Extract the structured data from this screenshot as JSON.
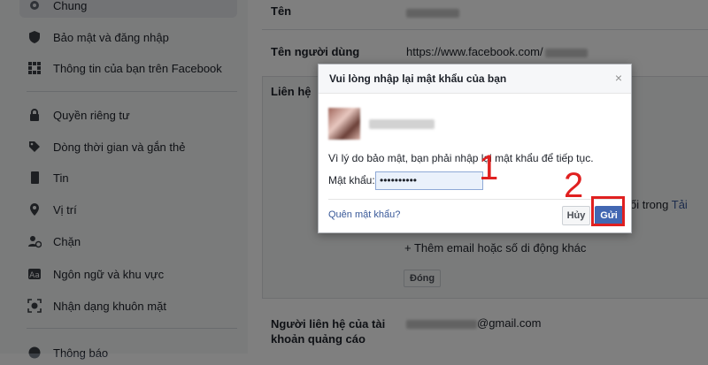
{
  "sidebar": {
    "items": [
      {
        "label": "Chung",
        "icon": "gear-icon",
        "top": 0
      },
      {
        "label": "Bảo mật và đăng nhập",
        "icon": "shield-icon"
      },
      {
        "label": "Thông tin của bạn trên Facebook",
        "icon": "grid-icon"
      },
      {
        "label": "Quyền riêng tư",
        "icon": "lock-icon"
      },
      {
        "label": "Dòng thời gian và gắn thẻ",
        "icon": "tag-icon"
      },
      {
        "label": "Tin",
        "icon": "book-icon"
      },
      {
        "label": "Vị trí",
        "icon": "location-pin-icon"
      },
      {
        "label": "Chặn",
        "icon": "block-user-icon"
      },
      {
        "label": "Ngôn ngữ và khu vực",
        "icon": "language-icon"
      },
      {
        "label": "Nhận dạng khuôn mặt",
        "icon": "face-recognition-icon"
      },
      {
        "label": "Thông báo",
        "icon": "globe-icon"
      }
    ]
  },
  "main": {
    "name_label": "Tên",
    "username_label": "Tên người dùng",
    "username_value": "https://www.facebook.com/",
    "contact_label": "Liên hệ",
    "contact_partial_right": "ối trong",
    "contact_partial_link": "Tải",
    "add_email": "+ Thêm email hoặc số di động khác",
    "close_button": "Đóng",
    "ad_contact_label": "Người liên hệ của tài khoản quảng cáo",
    "ad_contact_email": "@gmail.com"
  },
  "dialog": {
    "title": "Vui lòng nhập lại mật khẩu của bạn",
    "close_glyph": "×",
    "notice": "Vì lý do bảo mật, bạn phải nhập lại mật khẩu để tiếp tục.",
    "password_label": "Mật khẩu:",
    "password_value": "••••••••••",
    "forgot_link": "Quên mật khẩu?",
    "cancel_label": "Hủy",
    "send_label": "Gửi"
  },
  "annotations": {
    "step1": "1",
    "step2": "2",
    "highlight_color": "#e02020"
  },
  "colors": {
    "accent": "#4267b2",
    "link": "#385898"
  }
}
